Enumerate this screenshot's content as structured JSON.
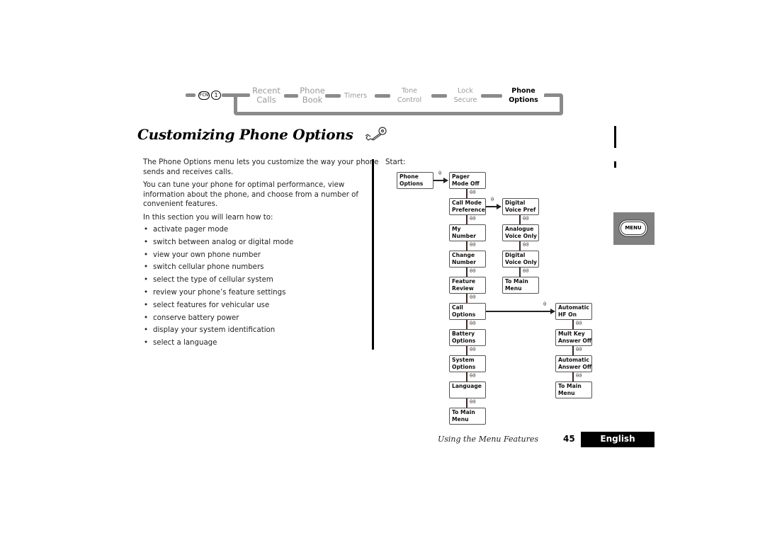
{
  "header_nav": {
    "key_icons": [
      "FCN",
      "1"
    ],
    "items": [
      {
        "line1": "Recent",
        "line2": "Calls",
        "active": false
      },
      {
        "line1": "Phone",
        "line2": "Book",
        "active": false
      },
      {
        "line1": "Timers",
        "line2": "",
        "active": false
      },
      {
        "line1": "Tone",
        "line2": "Control",
        "active": false
      },
      {
        "line1": "Lock",
        "line2": "Secure",
        "active": false
      },
      {
        "line1": "Phone",
        "line2": "Options",
        "active": true
      }
    ]
  },
  "title": "Customizing Phone Options",
  "title_icon": "wrench-icon",
  "intro": {
    "p1_line1": "The Phone Options menu lets you customize the way your phone",
    "p1_line2": "sends and receives calls.",
    "p2_line1": "You can tune your phone for optimal performance, view",
    "p2_line2": "information about the phone, and choose from a number of",
    "p2_line3": "convenient features.",
    "p3": "In this section you will learn how to:"
  },
  "bullets": [
    "activate pager mode",
    "switch between analog or digital mode",
    "view your own phone number",
    "switch cellular phone numbers",
    "select the type of cellular system",
    "review your phone’s feature settings",
    "select features for vehicular use",
    "conserve battery power",
    "display your system identification",
    "select a language"
  ],
  "bullet_glyph": "•",
  "flow": {
    "start_label": "Start:",
    "scroll_keys": "θϑ",
    "select_key": "θ",
    "root": {
      "l1": "Phone",
      "l2": "Options"
    },
    "main_column": [
      {
        "l1": "Pager",
        "l2": "Mode Off"
      },
      {
        "l1": "Call Mode",
        "l2": "Preference"
      },
      {
        "l1": "My",
        "l2": "Number"
      },
      {
        "l1": "Change",
        "l2": "Number"
      },
      {
        "l1": "Feature",
        "l2": "Review"
      },
      {
        "l1": "Call",
        "l2": "Options"
      },
      {
        "l1": "Battery",
        "l2": "Options"
      },
      {
        "l1": "System",
        "l2": "Options"
      },
      {
        "l1": "Language",
        "l2": ""
      },
      {
        "l1": "To Main",
        "l2": "Menu"
      }
    ],
    "call_mode_column": [
      {
        "l1": "Digital",
        "l2": "Voice Pref"
      },
      {
        "l1": "Analogue",
        "l2": "Voice Only"
      },
      {
        "l1": "Digital",
        "l2": "Voice Only"
      },
      {
        "l1": "To Main",
        "l2": "Menu"
      }
    ],
    "call_options_column": [
      {
        "l1": "Automatic",
        "l2": "HF On"
      },
      {
        "l1": "Mult Key",
        "l2": "Answer Off"
      },
      {
        "l1": "Automatic",
        "l2": "Answer Off"
      },
      {
        "l1": "To Main",
        "l2": "Menu"
      }
    ]
  },
  "side_tab": {
    "label": "MENU"
  },
  "footer": {
    "section": "Using the Menu Features",
    "page": "45",
    "language": "English"
  }
}
